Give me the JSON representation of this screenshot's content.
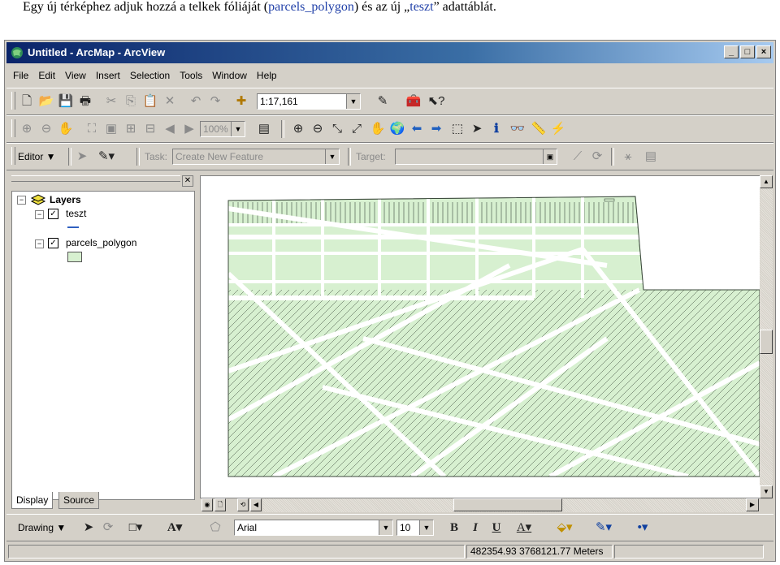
{
  "caption": {
    "part1": "Egy új térképhez adjuk hozzá a telkek fóliáját (",
    "part2": "parcels_polygon",
    "part3": ") és az új „",
    "part4": "teszt",
    "part5": "” adattáblát."
  },
  "window": {
    "title": "Untitled - ArcMap - ArcView",
    "controls": {
      "minimize": "_",
      "maximize": "□",
      "close": "×"
    }
  },
  "menu": [
    "File",
    "Edit",
    "View",
    "Insert",
    "Selection",
    "Tools",
    "Window",
    "Help"
  ],
  "standard_toolbar": {
    "scale": "1:17,161"
  },
  "tools_toolbar": {
    "zoom": "100%"
  },
  "editor_toolbar": {
    "editor_label": "Editor ▼",
    "task_label": "Task:",
    "task_value": "Create New Feature",
    "target_label": "Target:"
  },
  "toc": {
    "root": "Layers",
    "layers": [
      {
        "name": "teszt",
        "checked": true
      },
      {
        "name": "parcels_polygon",
        "checked": true
      }
    ],
    "tabs": [
      "Display",
      "Source"
    ]
  },
  "colors": {
    "parcel_fill": "#d7f0d0",
    "parcel_stroke": "#3c4a3c",
    "titlebar": "#0a246a"
  },
  "drawing_toolbar": {
    "drawing_label": "Drawing ▼",
    "font": "Arial",
    "font_size": "10",
    "bold": "B",
    "italic": "I",
    "underline": "U"
  },
  "status": {
    "coordinates": "482354.93  3768121.77 Meters"
  }
}
